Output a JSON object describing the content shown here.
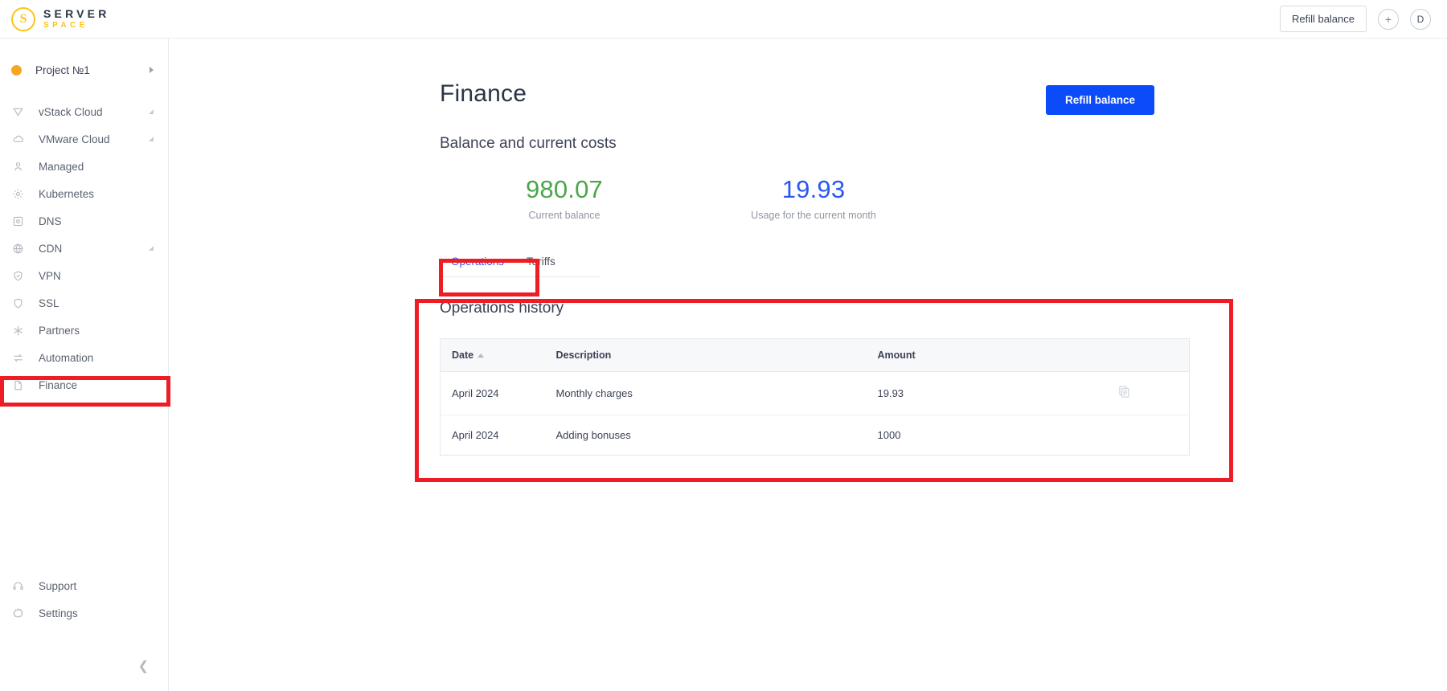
{
  "brand": {
    "name_top": "SERVER",
    "name_bottom": "SPACE",
    "mark": "S"
  },
  "topbar": {
    "refill_label": "Refill balance",
    "add_icon": "+",
    "avatar_initial": "D"
  },
  "sidebar": {
    "project": {
      "label": "Project №1",
      "caret_icon": "chevron-right-icon"
    },
    "items": [
      {
        "label": "vStack Cloud",
        "icon": "vstack-icon",
        "expandable": true
      },
      {
        "label": "VMware Cloud",
        "icon": "cloud-icon",
        "expandable": true
      },
      {
        "label": "Managed",
        "icon": "user-lock-icon",
        "expandable": false
      },
      {
        "label": "Kubernetes",
        "icon": "gear-icon",
        "expandable": false
      },
      {
        "label": "DNS",
        "icon": "dns-box-icon",
        "expandable": false
      },
      {
        "label": "CDN",
        "icon": "globe-icon",
        "expandable": true
      },
      {
        "label": "VPN",
        "icon": "shield-check-icon",
        "expandable": false
      },
      {
        "label": "SSL",
        "icon": "shield-icon",
        "expandable": false
      },
      {
        "label": "Partners",
        "icon": "asterisk-icon",
        "expandable": false
      },
      {
        "label": "Automation",
        "icon": "arrows-swap-icon",
        "expandable": false
      },
      {
        "label": "Finance",
        "icon": "document-icon",
        "expandable": false
      }
    ],
    "bottom_items": [
      {
        "label": "Support",
        "icon": "headset-icon"
      },
      {
        "label": "Settings",
        "icon": "settings-icon"
      }
    ],
    "collapse_icon": "chevron-left-icon"
  },
  "main": {
    "title": "Finance",
    "refill_label": "Refill balance",
    "subtitle": "Balance and current costs",
    "stats": [
      {
        "value": "980.07",
        "label": "Current balance",
        "color": "#4aa64a"
      },
      {
        "value": "19.93",
        "label": "Usage for the current month",
        "color": "#2b57f5"
      }
    ],
    "tabs": [
      {
        "label": "Operations",
        "active": true
      },
      {
        "label": "Tariffs",
        "active": false
      }
    ],
    "history": {
      "title": "Operations history",
      "columns": [
        {
          "key": "date",
          "label": "Date",
          "sort": "asc"
        },
        {
          "key": "description",
          "label": "Description"
        },
        {
          "key": "amount",
          "label": "Amount"
        },
        {
          "key": "action",
          "label": ""
        }
      ],
      "rows": [
        {
          "date": "April 2024",
          "description": "Monthly charges",
          "amount": "19.93",
          "action_icon": "documents-icon",
          "highlight": false
        },
        {
          "date": "April 2024",
          "description": "Adding bonuses",
          "amount": "1000",
          "action_icon": "",
          "highlight": true
        }
      ]
    }
  },
  "annotations": {
    "color": "#ee1c25",
    "boxes": [
      {
        "name": "sidebar-finance-highlight"
      },
      {
        "name": "operations-tab-highlight"
      },
      {
        "name": "operations-history-highlight"
      }
    ]
  }
}
